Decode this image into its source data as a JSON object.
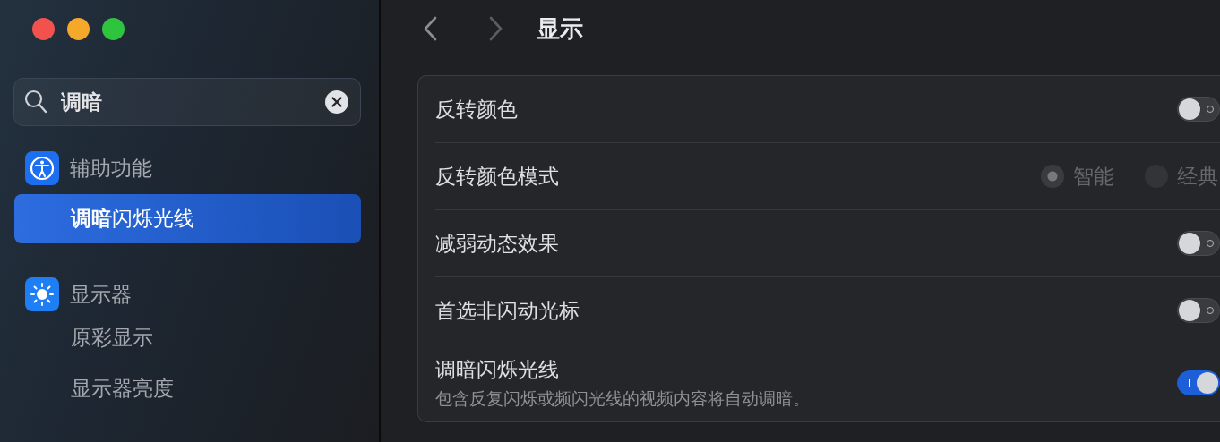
{
  "search": {
    "value": "调暗"
  },
  "sidebar": {
    "groups": [
      {
        "label": "辅助功能",
        "kind": "accessibility",
        "items": [
          {
            "label": "**调暗**闪烁光线",
            "selected": true
          }
        ]
      },
      {
        "label": "显示器",
        "kind": "display",
        "items": [
          {
            "label": "原彩显示",
            "selected": false
          },
          {
            "label": "显示器亮度",
            "selected": false
          }
        ]
      }
    ]
  },
  "main": {
    "title": "显示",
    "settings": [
      {
        "kind": "toggle",
        "label": "反转颜色",
        "on": false
      },
      {
        "kind": "radio",
        "label": "反转颜色模式",
        "disabled": true,
        "options": [
          {
            "label": "智能",
            "selected": true
          },
          {
            "label": "经典",
            "selected": false
          }
        ]
      },
      {
        "kind": "toggle",
        "label": "减弱动态效果",
        "on": false
      },
      {
        "kind": "toggle",
        "label": "首选非闪动光标",
        "on": false
      },
      {
        "kind": "toggle",
        "label": "调暗闪烁光线",
        "description": "包含反复闪烁或频闪光线的视频内容将自动调暗。",
        "on": true
      }
    ]
  }
}
